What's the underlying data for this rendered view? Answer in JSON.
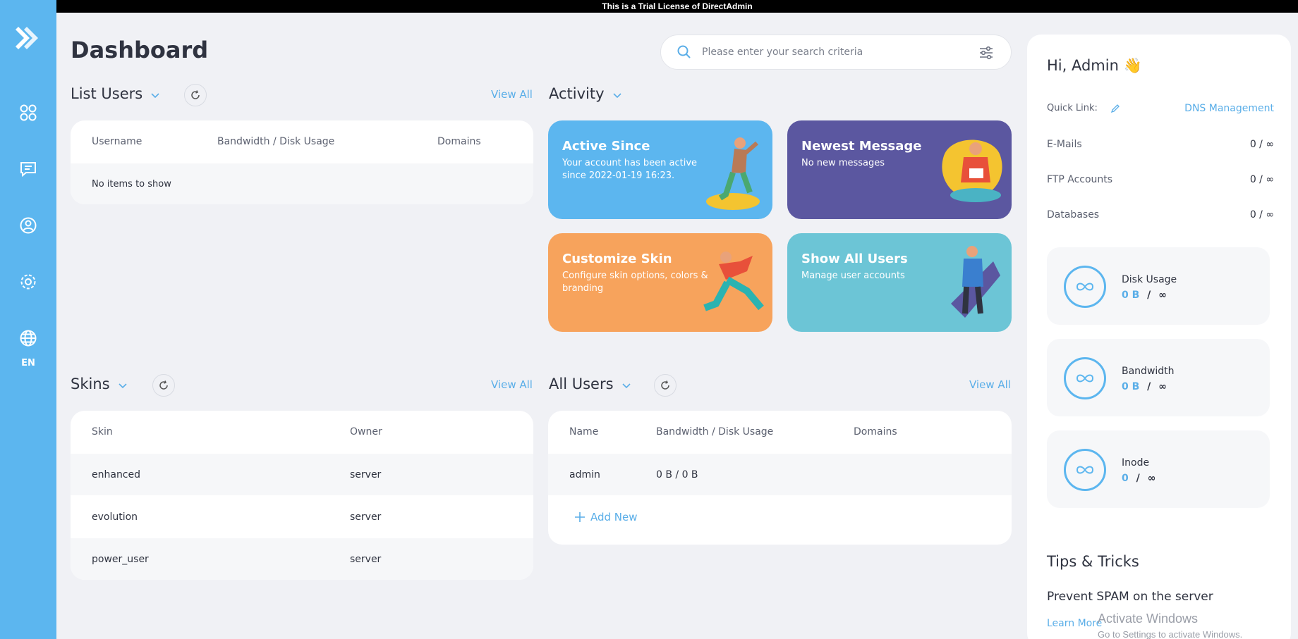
{
  "banner": "This is a Trial License of DirectAdmin",
  "page_title": "Dashboard",
  "search": {
    "placeholder": "Please enter your search criteria"
  },
  "sidebar": {
    "lang": "EN"
  },
  "list_users": {
    "title": "List Users",
    "view_all": "View All",
    "columns": [
      "Username",
      "Bandwidth / Disk Usage",
      "Domains"
    ],
    "empty": "No items to show"
  },
  "activity": {
    "title": "Activity",
    "tiles": [
      {
        "title": "Active Since",
        "desc": "Your account has been active since 2022-01-19 16:23.",
        "color": "#5cb6ef"
      },
      {
        "title": "Newest Message",
        "desc": "No new messages",
        "color": "#5b57a0"
      },
      {
        "title": "Customize Skin",
        "desc": "Configure skin options, colors & branding",
        "color": "#f7a35c"
      },
      {
        "title": "Show All Users",
        "desc": "Manage user accounts",
        "color": "#6cc5d6"
      }
    ]
  },
  "skins": {
    "title": "Skins",
    "view_all": "View All",
    "columns": [
      "Skin",
      "Owner"
    ],
    "rows": [
      {
        "skin": "enhanced",
        "owner": "server"
      },
      {
        "skin": "evolution",
        "owner": "server"
      },
      {
        "skin": "power_user",
        "owner": "server"
      }
    ]
  },
  "all_users": {
    "title": "All Users",
    "view_all": "View All",
    "columns": [
      "Name",
      "Bandwidth / Disk Usage",
      "Domains"
    ],
    "rows": [
      {
        "name": "admin",
        "usage": "0 B / 0 B",
        "domains": ""
      }
    ],
    "add_new": "Add New"
  },
  "right": {
    "greeting": "Hi, Admin 👋",
    "quick_link_label": "Quick Link:",
    "quick_link": "DNS Management",
    "stats": [
      {
        "label": "E-Mails",
        "value": "0 / ∞"
      },
      {
        "label": "FTP Accounts",
        "value": "0 / ∞"
      },
      {
        "label": "Databases",
        "value": "0 / ∞"
      }
    ],
    "usage": [
      {
        "label": "Disk Usage",
        "used": "0 B",
        "sep": "/",
        "limit": "∞"
      },
      {
        "label": "Bandwidth",
        "used": "0 B",
        "sep": "/",
        "limit": "∞"
      },
      {
        "label": "Inode",
        "used": "0",
        "sep": "/",
        "limit": "∞"
      }
    ],
    "tips_title": "Tips & Tricks",
    "tip": "Prevent SPAM on the server",
    "learn_more": "Learn More"
  },
  "watermark": {
    "line1": "Activate Windows",
    "line2": "Go to Settings to activate Windows."
  },
  "colors": {
    "accent": "#5cb6ef",
    "link": "#5aaee8",
    "background": "#f0f1f5"
  }
}
